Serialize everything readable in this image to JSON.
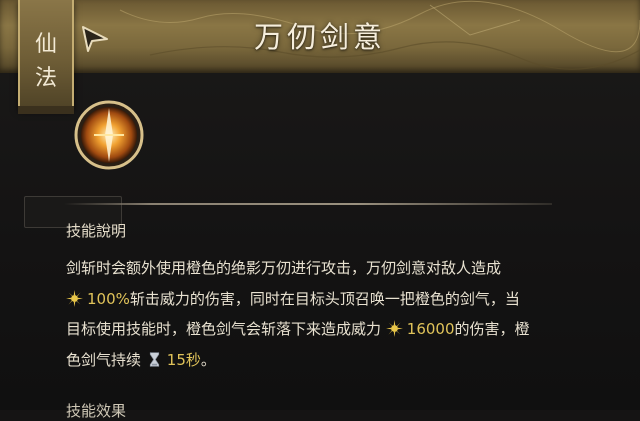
{
  "tab": {
    "label_1": "仙",
    "label_2": "法"
  },
  "header": {
    "title": "万仞剑意"
  },
  "skill": {
    "icon": "sword-emblem-icon"
  },
  "section": {
    "title": "技能說明"
  },
  "description": {
    "line1": "剑斩时会额外使用橙色的绝影万仞进行攻击，万仞剑意对敌人造成",
    "power_pct": "100%",
    "line2_rest": "斩击威力的伤害，同时在目标头顶召唤一把橙色的剑气，当",
    "line3_pre": "目标使用技能时，橙色剑气会斩落下来造成威力",
    "power_value": "16000",
    "line3_post": "的伤害，橙",
    "line4_pre": "色剑气持续",
    "duration": "15秒",
    "line4_post": "。",
    "power_icon": "burst-star-icon",
    "duration_icon": "hourglass-icon"
  },
  "next_section": {
    "title": "技能效果"
  },
  "colors": {
    "highlight": "#e0c35a",
    "text": "#e8e1d0",
    "banner": "#8a7645"
  }
}
